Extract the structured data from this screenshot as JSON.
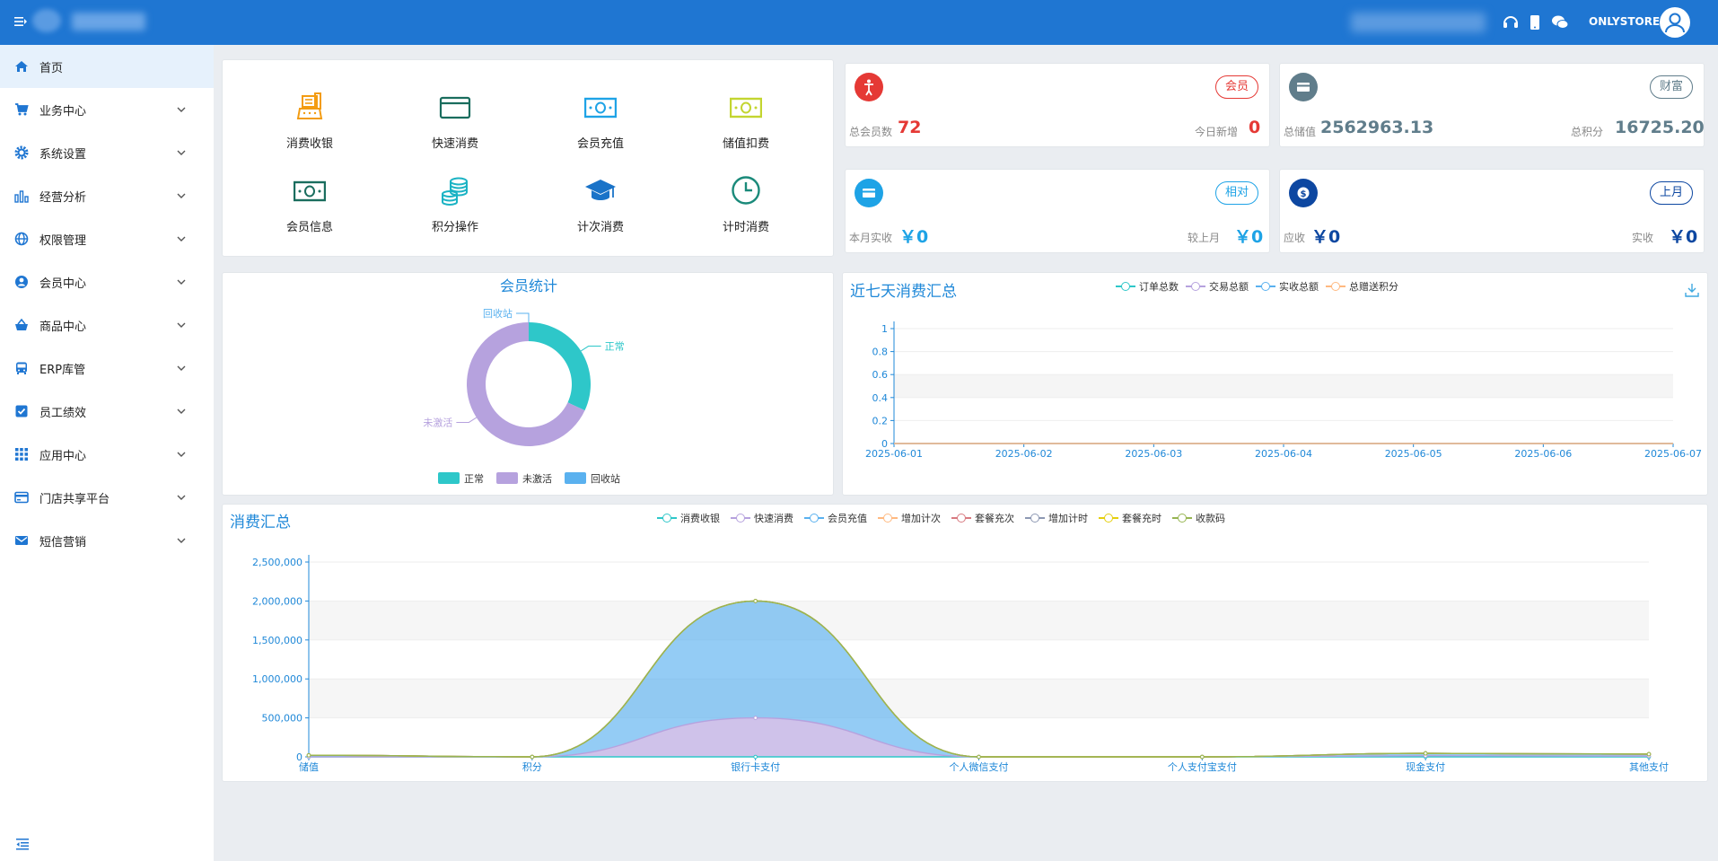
{
  "header": {
    "store_name": "ONLYSTORE"
  },
  "sidebar": {
    "items": [
      {
        "label": "首页",
        "icon": "home-icon"
      },
      {
        "label": "业务中心",
        "icon": "cart-icon"
      },
      {
        "label": "系统设置",
        "icon": "gear-icon"
      },
      {
        "label": "经营分析",
        "icon": "bar-chart-icon"
      },
      {
        "label": "权限管理",
        "icon": "globe-icon"
      },
      {
        "label": "会员中心",
        "icon": "user-icon"
      },
      {
        "label": "商品中心",
        "icon": "basket-icon"
      },
      {
        "label": "ERP库管",
        "icon": "bus-icon"
      },
      {
        "label": "员工绩效",
        "icon": "checkbox-icon"
      },
      {
        "label": "应用中心",
        "icon": "grid-icon"
      },
      {
        "label": "门店共享平台",
        "icon": "card-icon"
      },
      {
        "label": "短信营销",
        "icon": "mail-icon"
      }
    ]
  },
  "quick_actions": [
    {
      "label": "消费收银",
      "icon": "cash-register-icon",
      "color": "#f39c12"
    },
    {
      "label": "快速消费",
      "icon": "credit-card-icon",
      "color": "#1a6d5e"
    },
    {
      "label": "会员充值",
      "icon": "money-icon",
      "color": "#1ea3e6"
    },
    {
      "label": "储值扣费",
      "icon": "money-icon",
      "color": "#c3d530"
    },
    {
      "label": "会员信息",
      "icon": "money-icon",
      "color": "#1a6d5e"
    },
    {
      "label": "积分操作",
      "icon": "coins-icon",
      "color": "#1bb3c4"
    },
    {
      "label": "计次消费",
      "icon": "graduation-cap-icon",
      "color": "#1a73c8"
    },
    {
      "label": "计时消费",
      "icon": "clock-icon",
      "color": "#1a8a7a"
    }
  ],
  "stats": {
    "members": {
      "badge": "会员",
      "total_label": "总会员数",
      "total": "72",
      "new_label": "今日新增",
      "new": "0",
      "color": "#e53935"
    },
    "wealth": {
      "badge": "财富",
      "stored_label": "总储值",
      "stored": "2562963.13",
      "points_label": "总积分",
      "points": "16725.20",
      "color": "#607d8b"
    },
    "relative": {
      "badge": "相对",
      "month_label": "本月实收",
      "month": "￥0",
      "last_label": "较上月",
      "last": "￥0",
      "color": "#1ea3e6"
    },
    "last_month": {
      "badge": "上月",
      "due_label": "应收",
      "due": "￥0",
      "received_label": "实收",
      "received": "￥0",
      "color": "#0d47a1"
    }
  },
  "member_chart": {
    "title": "会员统计",
    "chart_data": {
      "type": "pie",
      "title": "会员统计",
      "categories": [
        "正常",
        "未激活",
        "回收站"
      ],
      "values": [
        23,
        49,
        0
      ],
      "colors": [
        "#2ec7c9",
        "#b6a2de",
        "#5ab1ef"
      ],
      "legend": "bottom"
    }
  },
  "week_chart": {
    "title": "近七天消费汇总",
    "chart_data": {
      "type": "line",
      "x": [
        "2025-06-01",
        "2025-06-02",
        "2025-06-03",
        "2025-06-04",
        "2025-06-05",
        "2025-06-06",
        "2025-06-07"
      ],
      "series": [
        {
          "name": "订单总数",
          "values": [
            0,
            0,
            0,
            0,
            0,
            0,
            0
          ],
          "color": "#2ec7c9"
        },
        {
          "name": "交易总额",
          "values": [
            0,
            0,
            0,
            0,
            0,
            0,
            0
          ],
          "color": "#b6a2de"
        },
        {
          "name": "实收总额",
          "values": [
            0,
            0,
            0,
            0,
            0,
            0,
            0
          ],
          "color": "#5ab1ef"
        },
        {
          "name": "总赠送积分",
          "values": [
            0,
            0,
            0,
            0,
            0,
            0,
            0
          ],
          "color": "#ffb980"
        }
      ],
      "ylim": [
        0,
        1
      ],
      "yticks": [
        "0",
        "0.2",
        "0.4",
        "0.6",
        "0.8",
        "1"
      ],
      "grid": true,
      "legend": "top"
    }
  },
  "summary_chart": {
    "title": "消费汇总",
    "chart_data": {
      "type": "area",
      "categories": [
        "储值",
        "积分",
        "银行卡支付",
        "个人微信支付",
        "个人支付宝支付",
        "现金支付",
        "其他支付"
      ],
      "series": [
        {
          "name": "消费收银",
          "values": [
            0,
            0,
            0,
            0,
            0,
            0,
            0
          ],
          "color": "#2ec7c9"
        },
        {
          "name": "快速消费",
          "values": [
            0,
            0,
            500000,
            0,
            0,
            15000,
            10000
          ],
          "color": "#b6a2de"
        },
        {
          "name": "会员充值",
          "values": [
            20000,
            0,
            1500000,
            0,
            0,
            30000,
            25000
          ],
          "color": "#5ab1ef"
        },
        {
          "name": "增加计次",
          "values": [
            0,
            0,
            0,
            0,
            0,
            0,
            0
          ],
          "color": "#ffb980"
        },
        {
          "name": "套餐充次",
          "values": [
            0,
            0,
            0,
            0,
            0,
            0,
            0
          ],
          "color": "#d87a80"
        },
        {
          "name": "增加计时",
          "values": [
            0,
            0,
            0,
            0,
            0,
            0,
            0
          ],
          "color": "#8d98b3"
        },
        {
          "name": "套餐充时",
          "values": [
            0,
            0,
            0,
            0,
            0,
            0,
            0
          ],
          "color": "#e5cf0d"
        },
        {
          "name": "收款码",
          "values": [
            0,
            0,
            0,
            0,
            0,
            0,
            0
          ],
          "color": "#97b552"
        }
      ],
      "ylim": [
        0,
        2500000
      ],
      "yticks": [
        "0",
        "500,000",
        "1,000,000",
        "1,500,000",
        "2,000,000",
        "2,500,000"
      ],
      "grid": true,
      "legend": "top"
    }
  }
}
